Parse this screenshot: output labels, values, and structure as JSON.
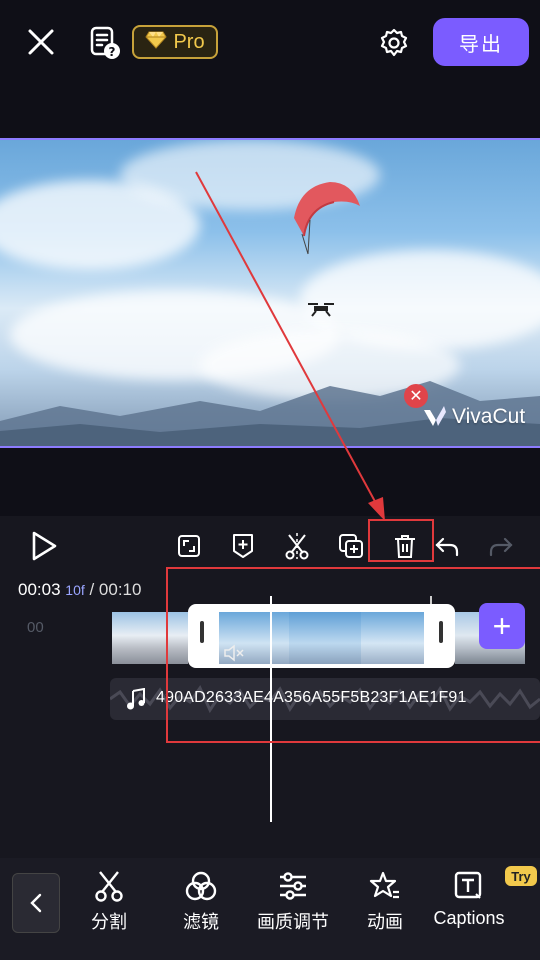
{
  "topbar": {
    "pro_label": "Pro",
    "export_label": "导出"
  },
  "preview": {
    "watermark_text": "VivaCut",
    "watermark_close": "✕"
  },
  "timeline": {
    "current_time": "00:03",
    "current_frame": "10f",
    "separator": " / ",
    "total_time": "00:10",
    "ruler_zero": "00",
    "audio_name": "490AD2633AE4A356A55F5B23F1AE1F91",
    "add_label": "+"
  },
  "toolbar": {
    "items": [
      {
        "label": "分割",
        "icon": "scissors-icon"
      },
      {
        "label": "滤镜",
        "icon": "filter-icon"
      },
      {
        "label": "画质调节",
        "icon": "adjust-icon"
      },
      {
        "label": "动画",
        "icon": "animation-icon"
      },
      {
        "label": "Captions",
        "icon": "captions-icon"
      }
    ],
    "try_badge": "Try"
  },
  "colors": {
    "accent": "#7b5cff",
    "annotation": "#e0393c",
    "pro_gold": "#f2c94c"
  }
}
